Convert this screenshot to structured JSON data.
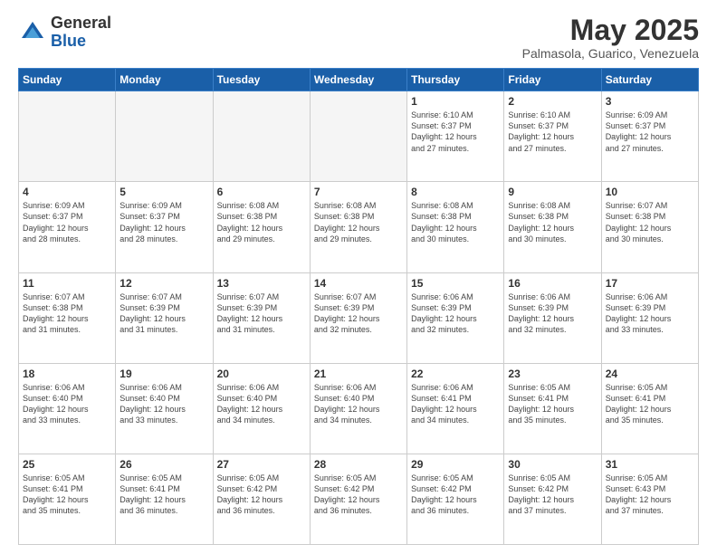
{
  "header": {
    "logo_general": "General",
    "logo_blue": "Blue",
    "month_title": "May 2025",
    "location": "Palmasola, Guarico, Venezuela"
  },
  "weekdays": [
    "Sunday",
    "Monday",
    "Tuesday",
    "Wednesday",
    "Thursday",
    "Friday",
    "Saturday"
  ],
  "weeks": [
    [
      {
        "day": "",
        "empty": true
      },
      {
        "day": "",
        "empty": true
      },
      {
        "day": "",
        "empty": true
      },
      {
        "day": "",
        "empty": true
      },
      {
        "day": "1",
        "lines": [
          "Sunrise: 6:10 AM",
          "Sunset: 6:37 PM",
          "Daylight: 12 hours",
          "and 27 minutes."
        ]
      },
      {
        "day": "2",
        "lines": [
          "Sunrise: 6:10 AM",
          "Sunset: 6:37 PM",
          "Daylight: 12 hours",
          "and 27 minutes."
        ]
      },
      {
        "day": "3",
        "lines": [
          "Sunrise: 6:09 AM",
          "Sunset: 6:37 PM",
          "Daylight: 12 hours",
          "and 27 minutes."
        ]
      }
    ],
    [
      {
        "day": "4",
        "lines": [
          "Sunrise: 6:09 AM",
          "Sunset: 6:37 PM",
          "Daylight: 12 hours",
          "and 28 minutes."
        ]
      },
      {
        "day": "5",
        "lines": [
          "Sunrise: 6:09 AM",
          "Sunset: 6:37 PM",
          "Daylight: 12 hours",
          "and 28 minutes."
        ]
      },
      {
        "day": "6",
        "lines": [
          "Sunrise: 6:08 AM",
          "Sunset: 6:38 PM",
          "Daylight: 12 hours",
          "and 29 minutes."
        ]
      },
      {
        "day": "7",
        "lines": [
          "Sunrise: 6:08 AM",
          "Sunset: 6:38 PM",
          "Daylight: 12 hours",
          "and 29 minutes."
        ]
      },
      {
        "day": "8",
        "lines": [
          "Sunrise: 6:08 AM",
          "Sunset: 6:38 PM",
          "Daylight: 12 hours",
          "and 30 minutes."
        ]
      },
      {
        "day": "9",
        "lines": [
          "Sunrise: 6:08 AM",
          "Sunset: 6:38 PM",
          "Daylight: 12 hours",
          "and 30 minutes."
        ]
      },
      {
        "day": "10",
        "lines": [
          "Sunrise: 6:07 AM",
          "Sunset: 6:38 PM",
          "Daylight: 12 hours",
          "and 30 minutes."
        ]
      }
    ],
    [
      {
        "day": "11",
        "lines": [
          "Sunrise: 6:07 AM",
          "Sunset: 6:38 PM",
          "Daylight: 12 hours",
          "and 31 minutes."
        ]
      },
      {
        "day": "12",
        "lines": [
          "Sunrise: 6:07 AM",
          "Sunset: 6:39 PM",
          "Daylight: 12 hours",
          "and 31 minutes."
        ]
      },
      {
        "day": "13",
        "lines": [
          "Sunrise: 6:07 AM",
          "Sunset: 6:39 PM",
          "Daylight: 12 hours",
          "and 31 minutes."
        ]
      },
      {
        "day": "14",
        "lines": [
          "Sunrise: 6:07 AM",
          "Sunset: 6:39 PM",
          "Daylight: 12 hours",
          "and 32 minutes."
        ]
      },
      {
        "day": "15",
        "lines": [
          "Sunrise: 6:06 AM",
          "Sunset: 6:39 PM",
          "Daylight: 12 hours",
          "and 32 minutes."
        ]
      },
      {
        "day": "16",
        "lines": [
          "Sunrise: 6:06 AM",
          "Sunset: 6:39 PM",
          "Daylight: 12 hours",
          "and 32 minutes."
        ]
      },
      {
        "day": "17",
        "lines": [
          "Sunrise: 6:06 AM",
          "Sunset: 6:39 PM",
          "Daylight: 12 hours",
          "and 33 minutes."
        ]
      }
    ],
    [
      {
        "day": "18",
        "lines": [
          "Sunrise: 6:06 AM",
          "Sunset: 6:40 PM",
          "Daylight: 12 hours",
          "and 33 minutes."
        ]
      },
      {
        "day": "19",
        "lines": [
          "Sunrise: 6:06 AM",
          "Sunset: 6:40 PM",
          "Daylight: 12 hours",
          "and 33 minutes."
        ]
      },
      {
        "day": "20",
        "lines": [
          "Sunrise: 6:06 AM",
          "Sunset: 6:40 PM",
          "Daylight: 12 hours",
          "and 34 minutes."
        ]
      },
      {
        "day": "21",
        "lines": [
          "Sunrise: 6:06 AM",
          "Sunset: 6:40 PM",
          "Daylight: 12 hours",
          "and 34 minutes."
        ]
      },
      {
        "day": "22",
        "lines": [
          "Sunrise: 6:06 AM",
          "Sunset: 6:41 PM",
          "Daylight: 12 hours",
          "and 34 minutes."
        ]
      },
      {
        "day": "23",
        "lines": [
          "Sunrise: 6:05 AM",
          "Sunset: 6:41 PM",
          "Daylight: 12 hours",
          "and 35 minutes."
        ]
      },
      {
        "day": "24",
        "lines": [
          "Sunrise: 6:05 AM",
          "Sunset: 6:41 PM",
          "Daylight: 12 hours",
          "and 35 minutes."
        ]
      }
    ],
    [
      {
        "day": "25",
        "lines": [
          "Sunrise: 6:05 AM",
          "Sunset: 6:41 PM",
          "Daylight: 12 hours",
          "and 35 minutes."
        ]
      },
      {
        "day": "26",
        "lines": [
          "Sunrise: 6:05 AM",
          "Sunset: 6:41 PM",
          "Daylight: 12 hours",
          "and 36 minutes."
        ]
      },
      {
        "day": "27",
        "lines": [
          "Sunrise: 6:05 AM",
          "Sunset: 6:42 PM",
          "Daylight: 12 hours",
          "and 36 minutes."
        ]
      },
      {
        "day": "28",
        "lines": [
          "Sunrise: 6:05 AM",
          "Sunset: 6:42 PM",
          "Daylight: 12 hours",
          "and 36 minutes."
        ]
      },
      {
        "day": "29",
        "lines": [
          "Sunrise: 6:05 AM",
          "Sunset: 6:42 PM",
          "Daylight: 12 hours",
          "and 36 minutes."
        ]
      },
      {
        "day": "30",
        "lines": [
          "Sunrise: 6:05 AM",
          "Sunset: 6:42 PM",
          "Daylight: 12 hours",
          "and 37 minutes."
        ]
      },
      {
        "day": "31",
        "lines": [
          "Sunrise: 6:05 AM",
          "Sunset: 6:43 PM",
          "Daylight: 12 hours",
          "and 37 minutes."
        ]
      }
    ]
  ]
}
